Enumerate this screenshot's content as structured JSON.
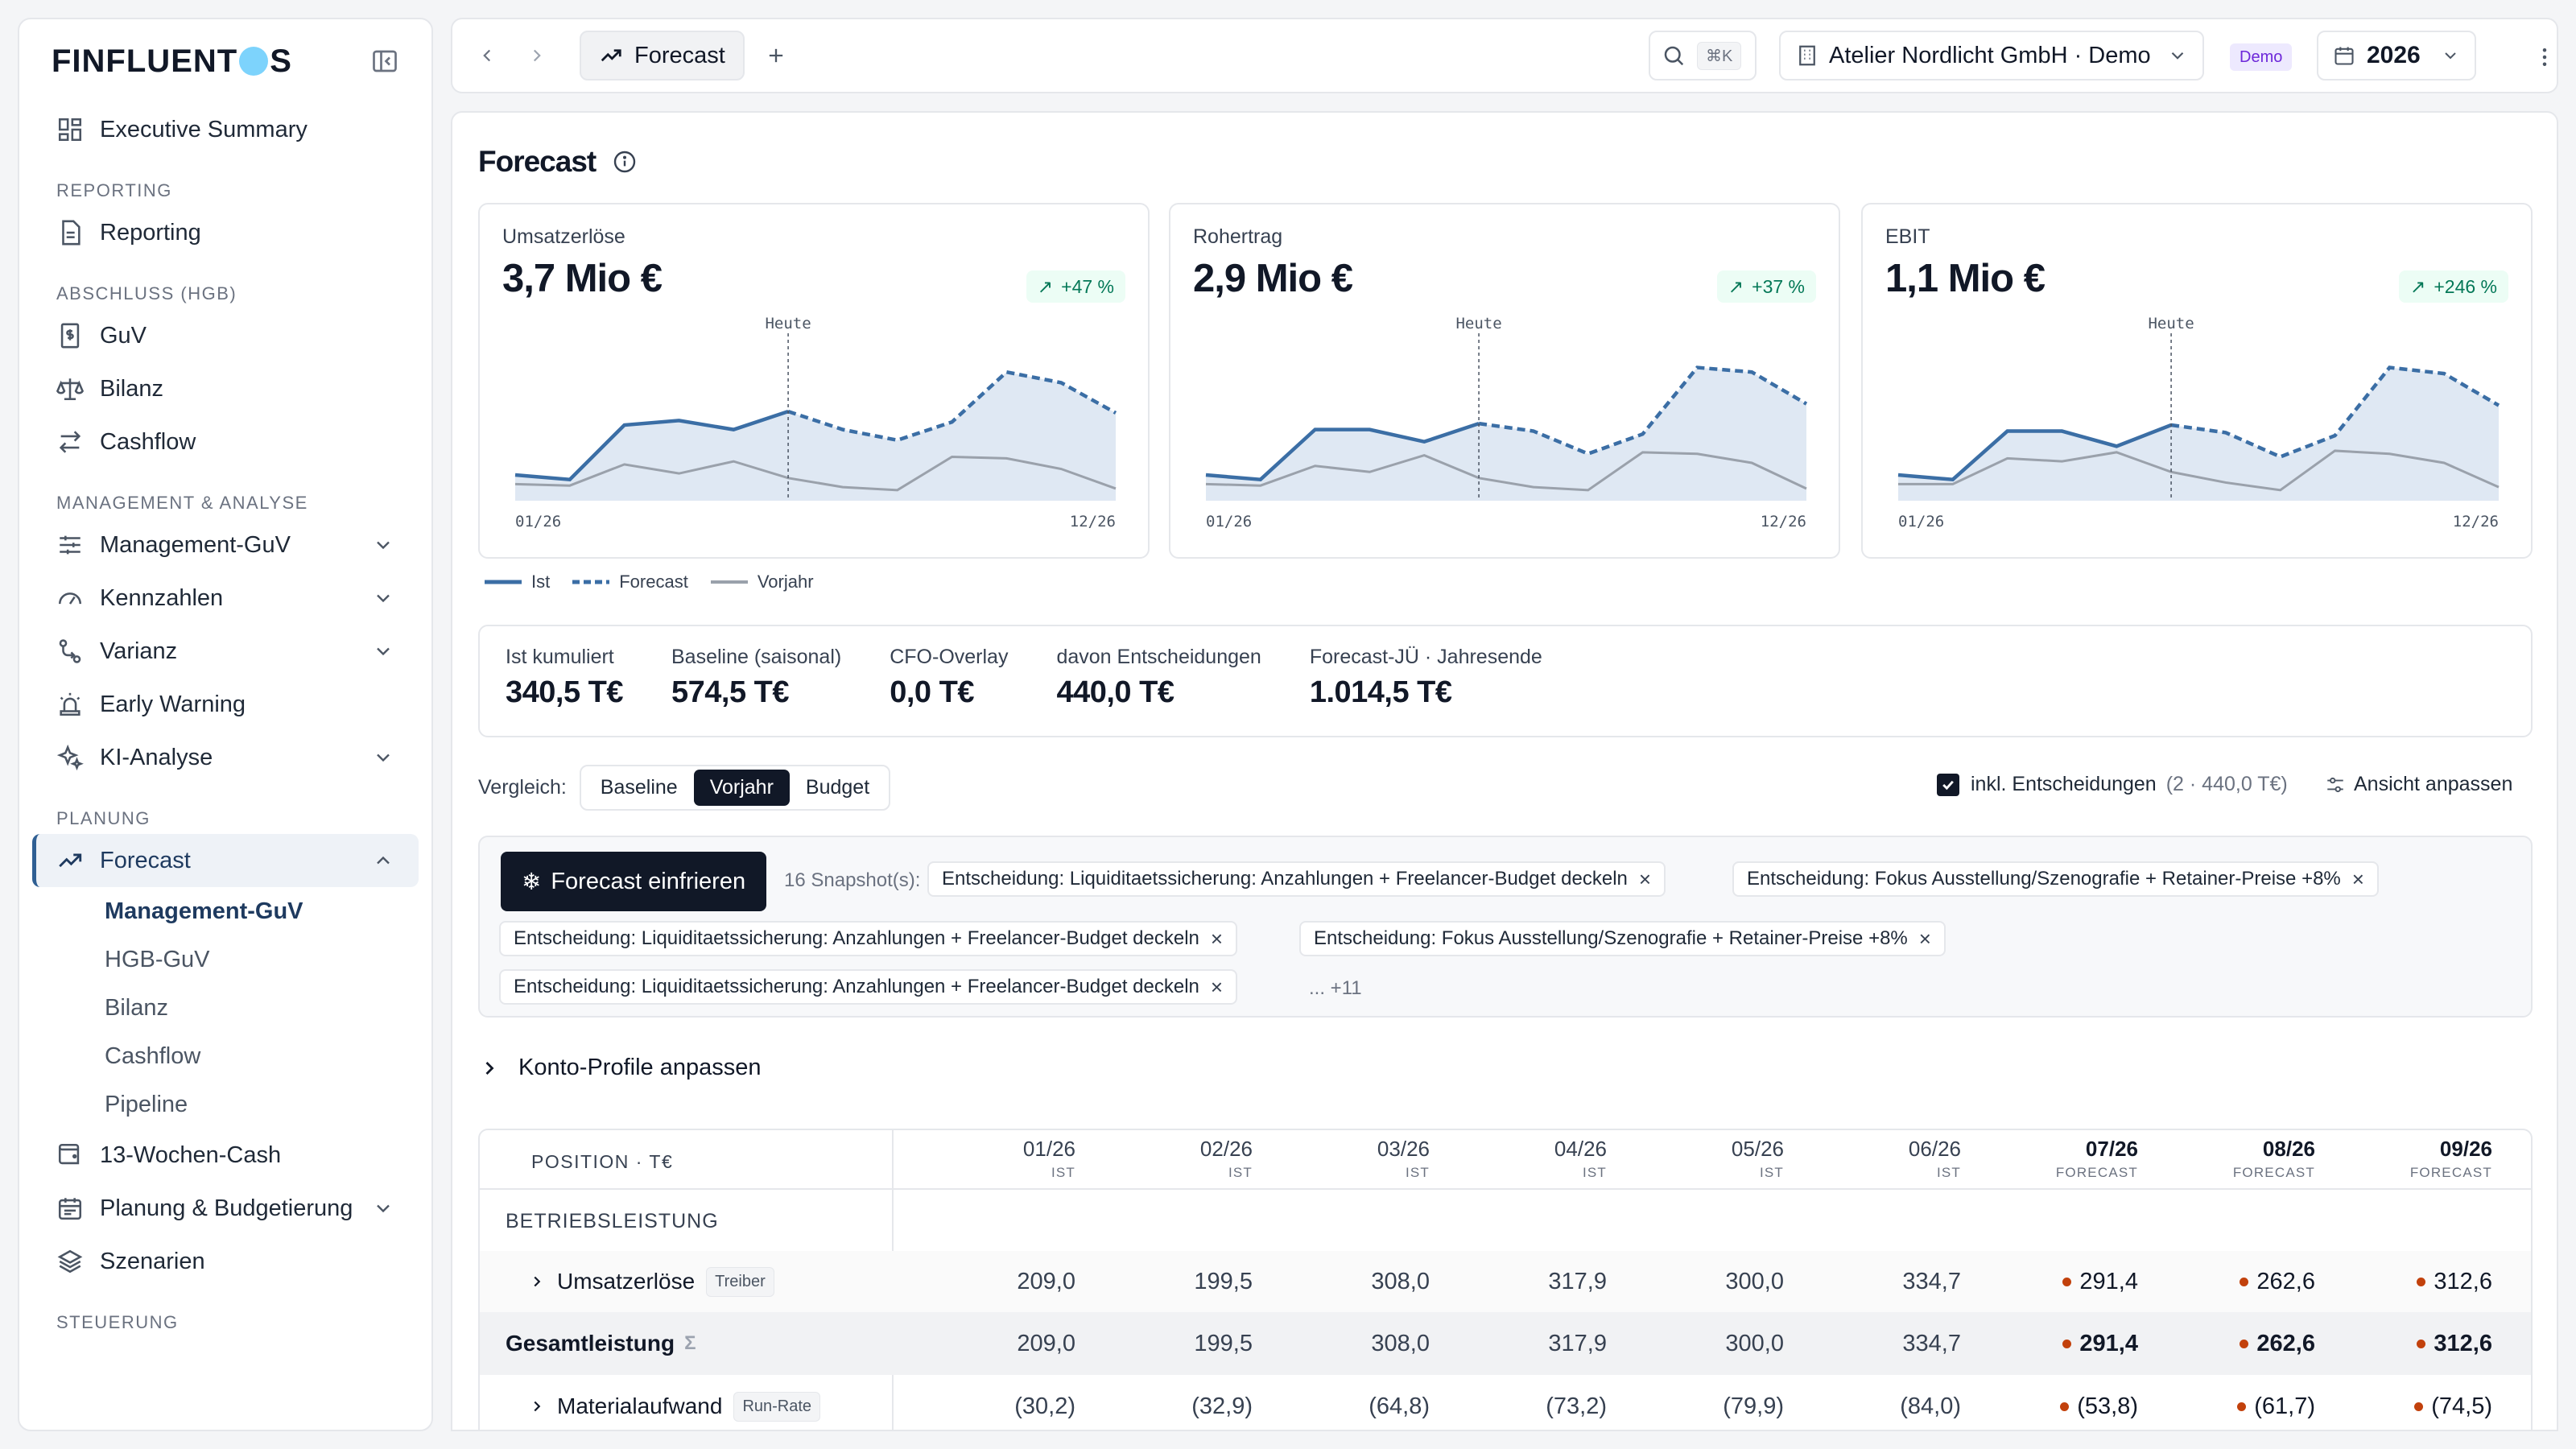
{
  "app": {
    "logo_left": "FINFLUENT",
    "logo_right": "S"
  },
  "sidebar": {
    "executive": "Executive Summary",
    "sections": {
      "reporting": "REPORTING",
      "abschluss": "ABSCHLUSS (HGB)",
      "management": "MANAGEMENT & ANALYSE",
      "planung": "PLANUNG",
      "steuerung": "STEUERUNG"
    },
    "items": {
      "reporting": "Reporting",
      "guv": "GuV",
      "bilanz": "Bilanz",
      "cashflow": "Cashflow",
      "mgmt_guv": "Management-GuV",
      "kennzahlen": "Kennzahlen",
      "varianz": "Varianz",
      "early_warning": "Early Warning",
      "ki": "KI-Analyse",
      "forecast": "Forecast",
      "wochen_cash": "13-Wochen-Cash",
      "planung_budget": "Planung & Budgetierung",
      "szenarien": "Szenarien"
    },
    "forecast_sub": [
      "Management-GuV",
      "HGB-GuV",
      "Bilanz",
      "Cashflow",
      "Pipeline"
    ]
  },
  "topbar": {
    "tab_label": "Forecast",
    "shortcut": "⌘K",
    "company": "Atelier Nordlicht GmbH · Demo",
    "demo_badge": "Demo",
    "year": "2026"
  },
  "page": {
    "title": "Forecast"
  },
  "kpis": [
    {
      "label": "Umsatzerlöse",
      "value": "3,7 Mio €",
      "delta": "+47 %"
    },
    {
      "label": "Rohertrag",
      "value": "2,9 Mio €",
      "delta": "+37 %"
    },
    {
      "label": "EBIT",
      "value": "1,1 Mio €",
      "delta": "+246 %"
    }
  ],
  "sparkline": {
    "today_label": "Heute",
    "start_label": "01/26",
    "end_label": "12/26",
    "legend": {
      "ist": "Ist",
      "forecast": "Forecast",
      "vorjahr": "Vorjahr"
    }
  },
  "chart_data": [
    {
      "type": "line",
      "title": "Umsatzerlöse",
      "x": [
        "01/26",
        "02/26",
        "03/26",
        "04/26",
        "05/26",
        "06/26",
        "07/26",
        "08/26",
        "09/26",
        "10/26",
        "11/26",
        "12/26"
      ],
      "series": [
        {
          "name": "Ist",
          "values": [
            0.17,
            0.14,
            0.5,
            0.53,
            0.47,
            0.59,
            null,
            null,
            null,
            null,
            null,
            null
          ]
        },
        {
          "name": "Forecast",
          "values": [
            null,
            null,
            null,
            null,
            null,
            0.59,
            0.47,
            0.4,
            0.52,
            0.85,
            0.78,
            0.58
          ]
        },
        {
          "name": "Vorjahr",
          "values": [
            0.11,
            0.1,
            0.24,
            0.18,
            0.26,
            0.15,
            0.09,
            0.07,
            0.29,
            0.28,
            0.21,
            0.08
          ]
        }
      ]
    },
    {
      "type": "line",
      "title": "Rohertrag",
      "x": [
        "01/26",
        "02/26",
        "03/26",
        "04/26",
        "05/26",
        "06/26",
        "07/26",
        "08/26",
        "09/26",
        "10/26",
        "11/26",
        "12/26"
      ],
      "series": [
        {
          "name": "Ist",
          "values": [
            0.17,
            0.14,
            0.47,
            0.47,
            0.39,
            0.51,
            null,
            null,
            null,
            null,
            null,
            null
          ]
        },
        {
          "name": "Forecast",
          "values": [
            null,
            null,
            null,
            null,
            null,
            0.51,
            0.46,
            0.31,
            0.44,
            0.88,
            0.85,
            0.64
          ]
        },
        {
          "name": "Vorjahr",
          "values": [
            0.11,
            0.1,
            0.23,
            0.19,
            0.3,
            0.15,
            0.09,
            0.07,
            0.32,
            0.31,
            0.25,
            0.08
          ]
        }
      ]
    },
    {
      "type": "line",
      "title": "EBIT",
      "x": [
        "01/26",
        "02/26",
        "03/26",
        "04/26",
        "05/26",
        "06/26",
        "07/26",
        "08/26",
        "09/26",
        "10/26",
        "11/26",
        "12/26"
      ],
      "series": [
        {
          "name": "Ist",
          "values": [
            0.17,
            0.14,
            0.46,
            0.46,
            0.36,
            0.5,
            null,
            null,
            null,
            null,
            null,
            null
          ]
        },
        {
          "name": "Forecast",
          "values": [
            null,
            null,
            null,
            null,
            null,
            0.5,
            0.45,
            0.29,
            0.43,
            0.88,
            0.84,
            0.63
          ]
        },
        {
          "name": "Vorjahr",
          "values": [
            0.11,
            0.11,
            0.28,
            0.26,
            0.32,
            0.19,
            0.12,
            0.07,
            0.33,
            0.31,
            0.25,
            0.09
          ]
        }
      ]
    }
  ],
  "stats": [
    {
      "label": "Ist kumuliert",
      "value": "340,5 T€"
    },
    {
      "label": "Baseline (saisonal)",
      "value": "574,5 T€"
    },
    {
      "label": "CFO-Overlay",
      "value": "0,0 T€"
    },
    {
      "label": "davon Entscheidungen",
      "value": "440,0 T€"
    },
    {
      "label": "Forecast-JÜ · Jahresende",
      "value": "1.014,5 T€"
    }
  ],
  "compare": {
    "label": "Vergleich:",
    "options": [
      "Baseline",
      "Vorjahr",
      "Budget"
    ],
    "selected": "Vorjahr"
  },
  "decisions_toggle": {
    "label": "inkl. Entscheidungen",
    "detail": "(2 · 440,0 T€)",
    "checked": true
  },
  "adjust_view": "Ansicht anpassen",
  "snapshots": {
    "freeze_button": "Forecast einfrieren",
    "count": "16 Snapshot(s):",
    "chips": [
      "Entscheidung: Liquiditaetssicherung: Anzahlungen + Freelancer-Budget deckeln",
      "Entscheidung: Fokus Ausstellung/Szenografie + Retainer-Preise +8%",
      "Entscheidung: Liquiditaetssicherung: Anzahlungen + Freelancer-Budget deckeln",
      "Entscheidung: Fokus Ausstellung/Szenografie + Retainer-Preise +8%",
      "Entscheidung: Liquiditaetssicherung: Anzahlungen + Freelancer-Budget deckeln"
    ],
    "more": "... +11"
  },
  "konto": "Konto-Profile anpassen",
  "table": {
    "position_header": "POSITION · T€",
    "columns": [
      {
        "month": "01/26",
        "kind": "IST"
      },
      {
        "month": "02/26",
        "kind": "IST"
      },
      {
        "month": "03/26",
        "kind": "IST"
      },
      {
        "month": "04/26",
        "kind": "IST"
      },
      {
        "month": "05/26",
        "kind": "IST"
      },
      {
        "month": "06/26",
        "kind": "IST"
      },
      {
        "month": "07/26",
        "kind": "FORECAST"
      },
      {
        "month": "08/26",
        "kind": "FORECAST"
      },
      {
        "month": "09/26",
        "kind": "FORECAST"
      }
    ],
    "group": "BETRIEBSLEISTUNG",
    "rows": [
      {
        "label": "Umsatzerlöse",
        "tag": "Treiber",
        "values": [
          "209,0",
          "199,5",
          "308,0",
          "317,9",
          "300,0",
          "334,7",
          "291,4",
          "262,6",
          "312,6"
        ]
      },
      {
        "label": "Gesamtleistung",
        "sigma": "Σ",
        "values": [
          "209,0",
          "199,5",
          "308,0",
          "317,9",
          "300,0",
          "334,7",
          "291,4",
          "262,6",
          "312,6"
        ]
      },
      {
        "label": "Materialaufwand",
        "tag": "Run-Rate",
        "values": [
          "(30,2)",
          "(32,9)",
          "(64,8)",
          "(73,2)",
          "(79,9)",
          "(84,0)",
          "(53,8)",
          "(61,7)",
          "(74,5)"
        ]
      }
    ]
  }
}
